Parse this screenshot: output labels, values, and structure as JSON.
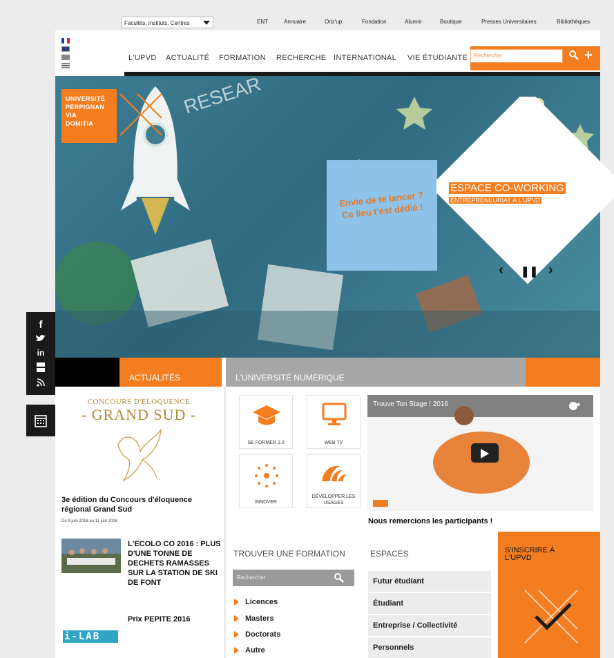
{
  "topbar": {
    "select_value": "Facultés, Instituts, Centres",
    "links": [
      "ENT",
      "Annuaire",
      "Oriz'up",
      "Fondation",
      "Alumni",
      "Boutique",
      "Presses Universitaires",
      "Bibliothèques"
    ]
  },
  "nav": {
    "items": [
      "L'UPVD",
      "ACTUALITÉ",
      "FORMATION",
      "RECHERCHE",
      "INTERNATIONAL",
      "VIE ÉTUDIANTE"
    ],
    "search_placeholder": "Rechercher"
  },
  "hero": {
    "logo_lines": [
      "UNIVERSITÉ",
      "PERPIGNAN",
      "VIA",
      "DOMITIA"
    ],
    "card_text": "Envie de te lancer ? Ce lieu t'est dédié !",
    "slide_title": "ESPACE CO-WORKING",
    "slide_subtitle": "ENTREPRENEURIAT À L'UPVD",
    "controls": {
      "prev": "‹",
      "pause": "❚❚",
      "next": "›"
    }
  },
  "social": [
    "f",
    "in"
  ],
  "bands": {
    "actualites": "ACTUALITÉS",
    "numerique": "L'UNIVERSITÉ NUMÉRIQUE"
  },
  "actualites": {
    "concours_img_lines": [
      "CONCOURS D'ÉLOQUENCE",
      "- GRAND SUD -"
    ],
    "featured_title": "3e édition du Concours d'éloquence régional Grand Sud",
    "featured_date": "Du 9 juin 2016 au 11 juin 2016",
    "items": [
      {
        "title": "L'ECOLO CO 2016 : PLUS D'UNE TONNE DE DECHETS RAMASSES SUR LA STATION DE SKI DE FONT"
      },
      {
        "title": "Prix PEPITE 2016"
      }
    ],
    "ilab_label": "i-LAB"
  },
  "tiles": [
    {
      "label": "SE FORMER 2.0"
    },
    {
      "label": "WEB TV"
    },
    {
      "label": "INNOVER"
    },
    {
      "label": "DÉVELOPPER LES USAGES"
    }
  ],
  "video": {
    "title": "Trouve Ton Stage ! 2016",
    "caption": "Nous remercions les participants !"
  },
  "formation": {
    "title": "TROUVER UNE FORMATION",
    "search_placeholder": "Rechercher",
    "items": [
      "Licences",
      "Masters",
      "Doctorats",
      "Autre"
    ]
  },
  "espaces": {
    "title": "ESPACES",
    "items": [
      "Futur étudiant",
      "Étudiant",
      "Entreprise / Collectivité",
      "Personnels"
    ]
  },
  "inscrire": {
    "title_lines": [
      "S'INSCRIRE À",
      "L'UPVD"
    ]
  },
  "colors": {
    "accent": "#f47d1f",
    "dark": "#1a1a1a",
    "grey": "#a7a7a7"
  }
}
